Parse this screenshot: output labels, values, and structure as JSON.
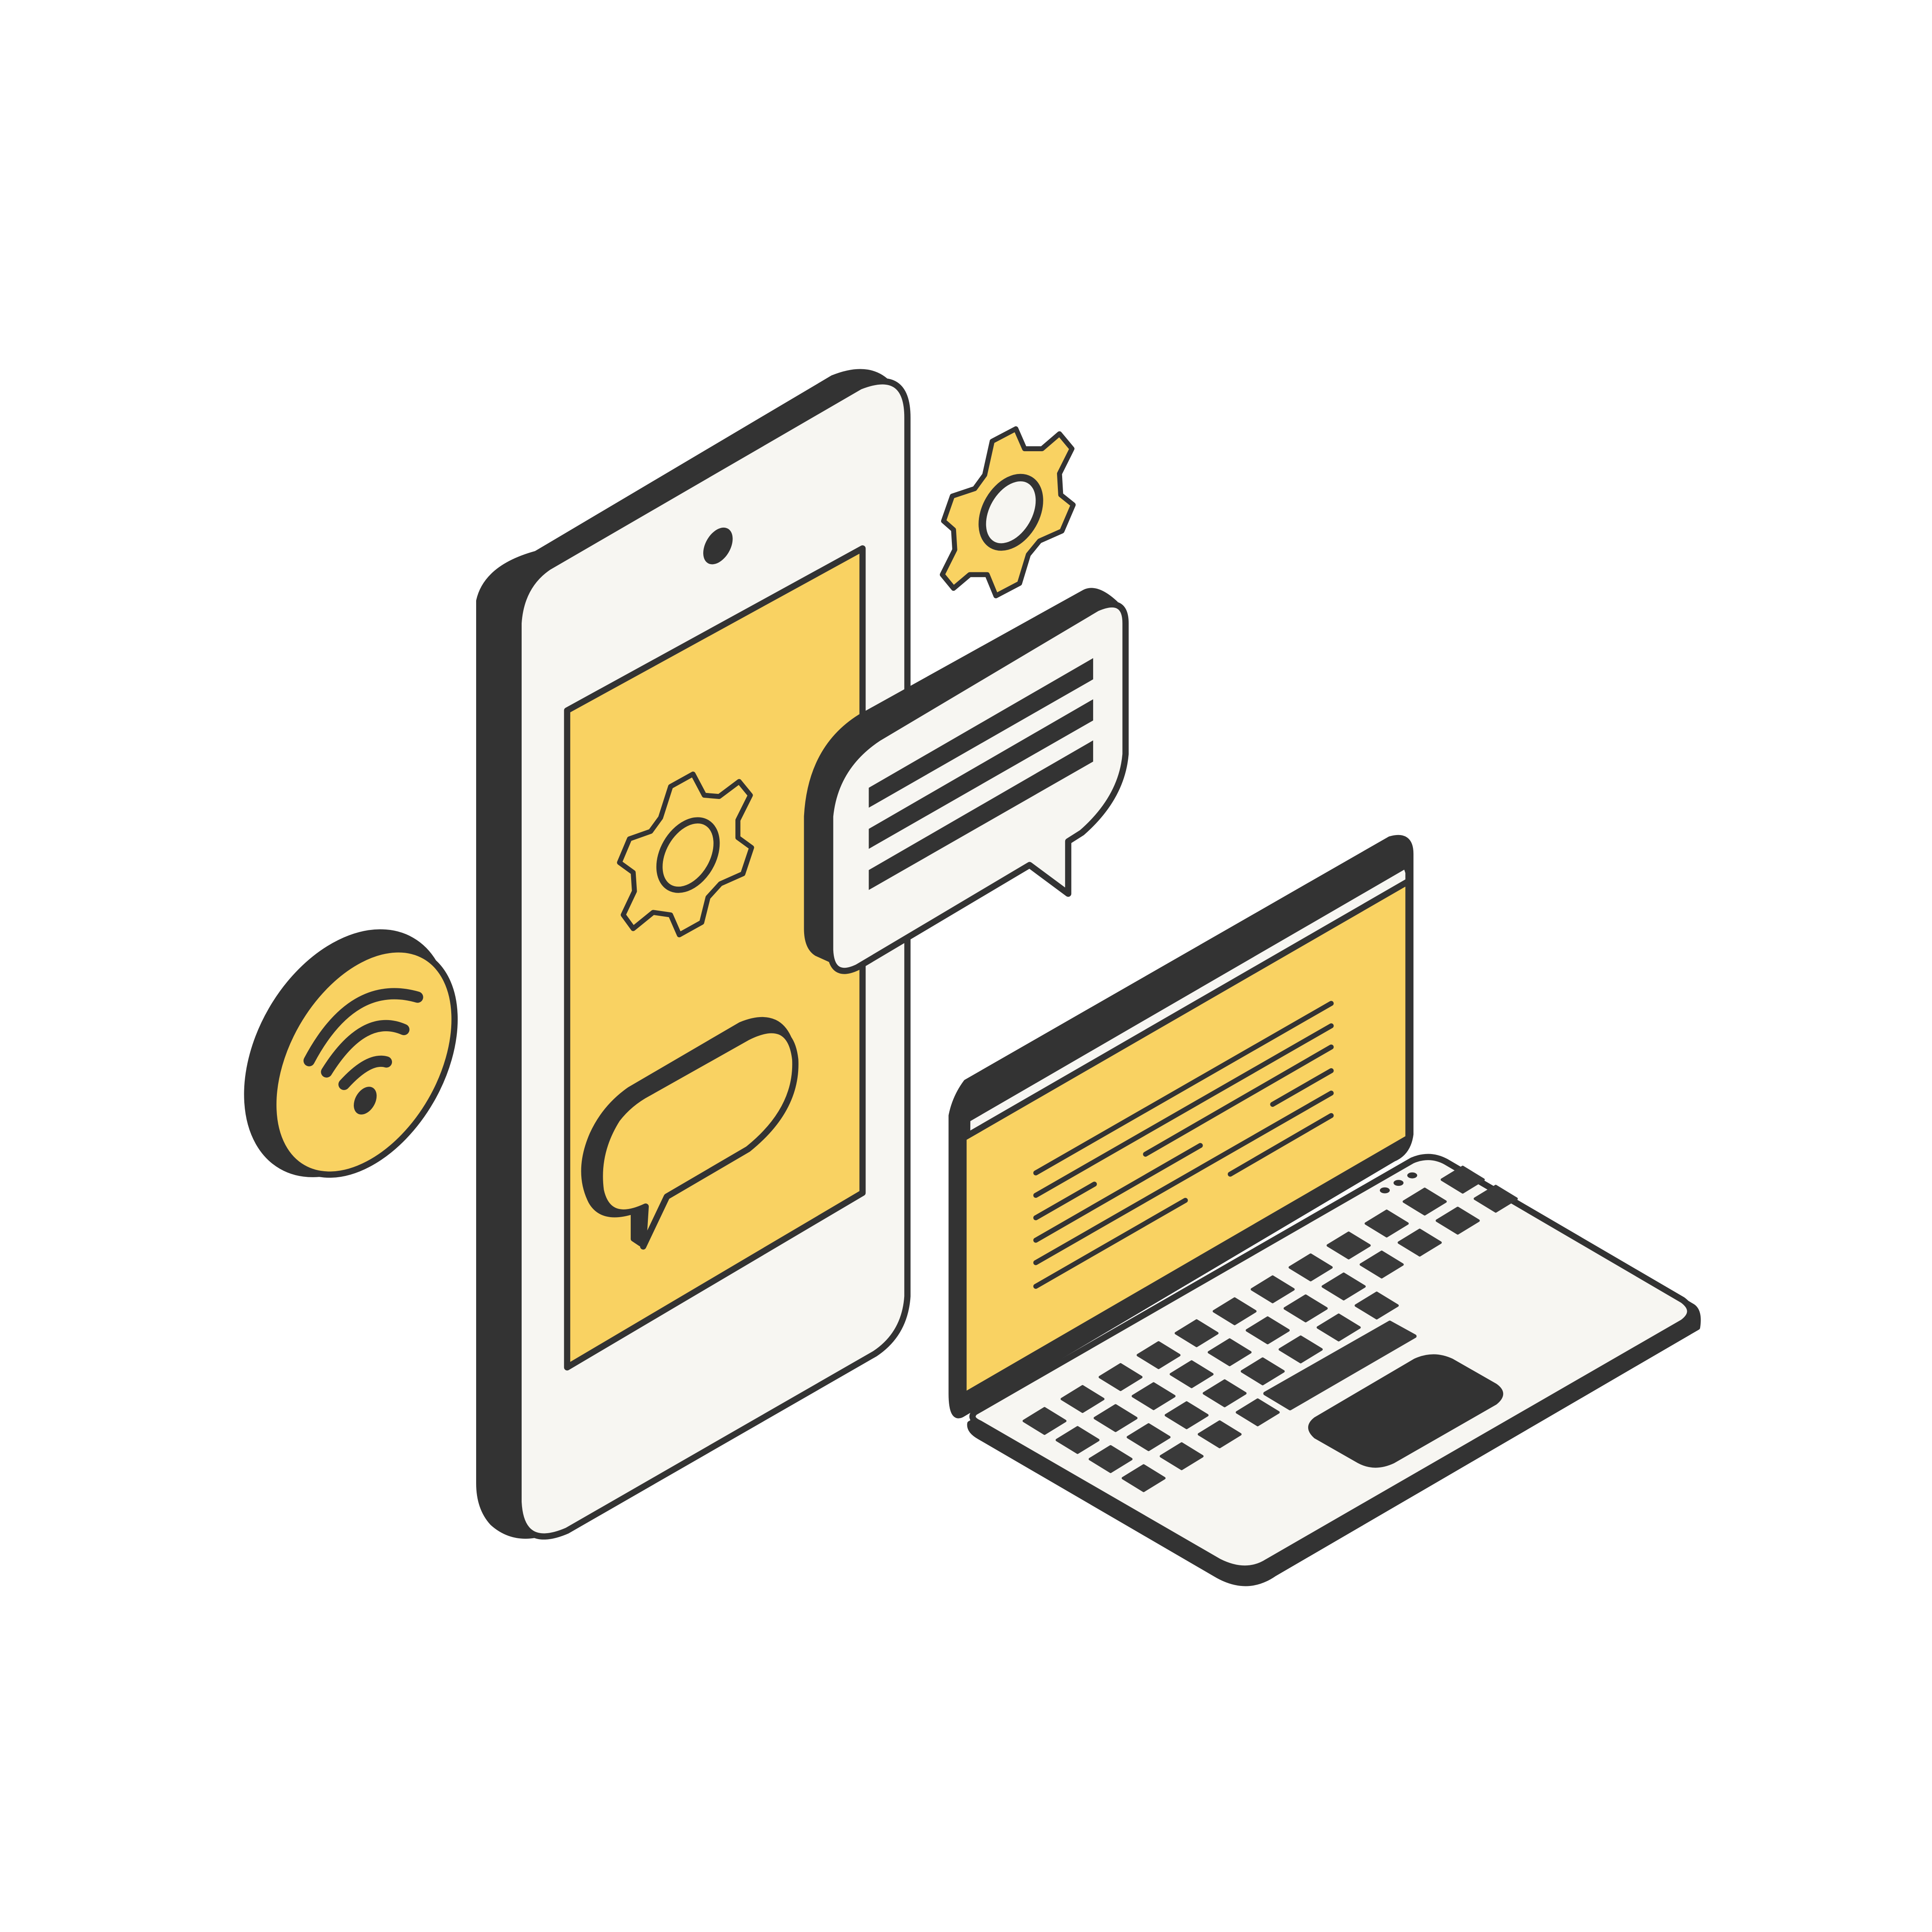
{
  "colors": {
    "background": "#ffffff",
    "outline": "#333333",
    "accent": "#f9d262",
    "surface": "#f7f6f2",
    "key": "#3a3a3a"
  },
  "icons": [
    "smartphone-icon",
    "gear-icon",
    "speech-bubble-icon",
    "wifi-icon",
    "laptop-icon",
    "message-lines-icon"
  ]
}
